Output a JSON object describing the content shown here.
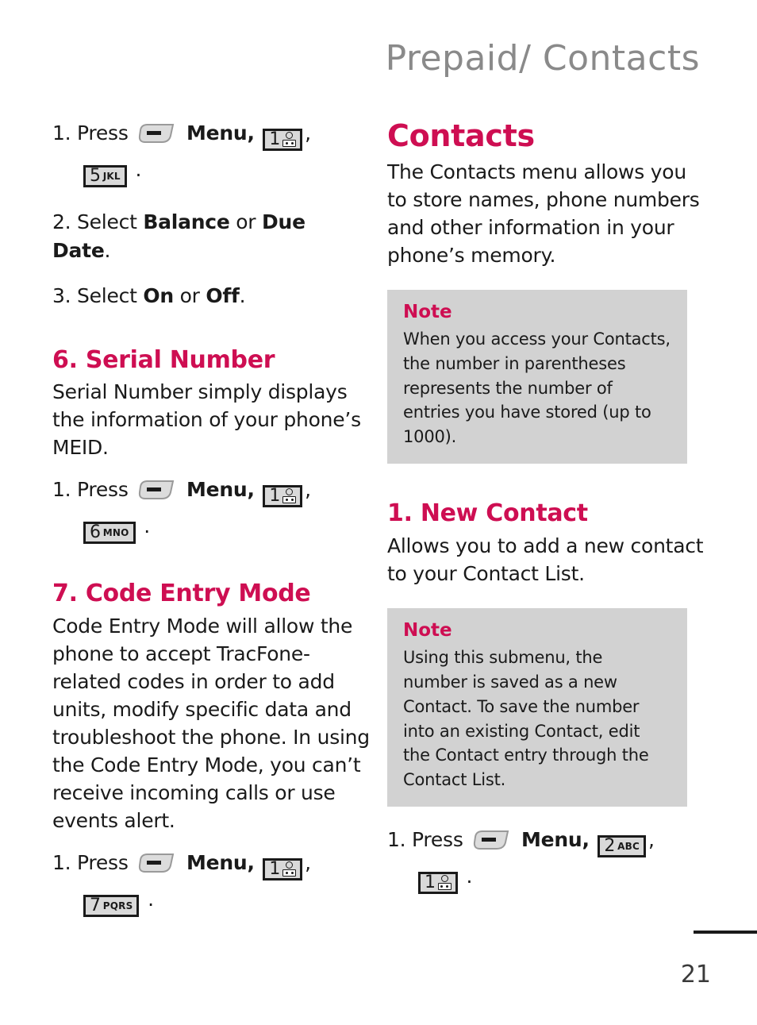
{
  "header": {
    "title": "Prepaid/ Contacts"
  },
  "colors": {
    "accent": "#CE0E52",
    "header_gray": "#8A8A8A",
    "note_background": "#D2D2D2",
    "body_text": "#1A1A1A"
  },
  "left_column": {
    "steps_prepaid": {
      "step1_prefix": "1. Press",
      "step1_menu": "Menu,",
      "step1_key1": {
        "num": "1",
        "letters": "",
        "icon": "voicemail-icon"
      },
      "step1_comma": ",",
      "step1_key2": {
        "num": "5",
        "letters": "JKL",
        "icon": ""
      },
      "step1_period": ".",
      "step2": "2. Select ",
      "step2_bold1": "Balance",
      "step2_mid": " or ",
      "step2_bold2": "Due Date",
      "step2_end": ".",
      "step3": "3. Select ",
      "step3_bold1": "On",
      "step3_mid": " or ",
      "step3_bold2": "Off",
      "step3_end": "."
    },
    "serial_number": {
      "title": "6. Serial Number",
      "body": "Serial Number simply displays the information of your phone’s MEID.",
      "step1_prefix": "1. Press",
      "step1_menu": "Menu,",
      "step1_key1": {
        "num": "1",
        "letters": "",
        "icon": "voicemail-icon"
      },
      "step1_comma": ",",
      "step1_key2": {
        "num": "6",
        "letters": "MNO",
        "icon": ""
      },
      "step1_period": "."
    },
    "code_entry_mode": {
      "title": "7. Code Entry Mode",
      "body": "Code Entry Mode will allow the phone to accept TracFone-related codes in order to add units, modify specific data and troubleshoot the phone. In using the Code Entry Mode, you can’t receive incoming calls or use events alert.",
      "step1_prefix": "1. Press",
      "step1_menu": "Menu,",
      "step1_key1": {
        "num": "1",
        "letters": "",
        "icon": "voicemail-icon"
      },
      "step1_comma": ",",
      "step1_key2": {
        "num": "7",
        "letters": "PQRS",
        "icon": ""
      },
      "step1_period": "."
    }
  },
  "right_column": {
    "contacts": {
      "title": "Contacts",
      "body": "The Contacts menu allows you to store names, phone numbers and other information in your phone’s memory."
    },
    "note1": {
      "title": "Note",
      "body": "When you access your Contacts, the number in parentheses represents the number of entries you have stored (up to 1000)."
    },
    "new_contact": {
      "title": "1. New Contact",
      "body": "Allows you to add a new contact to your Contact List."
    },
    "note2": {
      "title": "Note",
      "body": "Using this submenu, the number is saved as a new Contact. To save the number into an existing Contact, edit the Contact entry through the Contact List."
    },
    "steps_new_contact": {
      "step1_prefix": "1. Press",
      "step1_menu": "Menu,",
      "step1_key1": {
        "num": "2",
        "letters": "ABC",
        "icon": ""
      },
      "step1_comma": ",",
      "step1_key2": {
        "num": "1",
        "letters": "",
        "icon": "voicemail-icon"
      },
      "step1_period": "."
    }
  },
  "footer": {
    "page_number": "21"
  }
}
